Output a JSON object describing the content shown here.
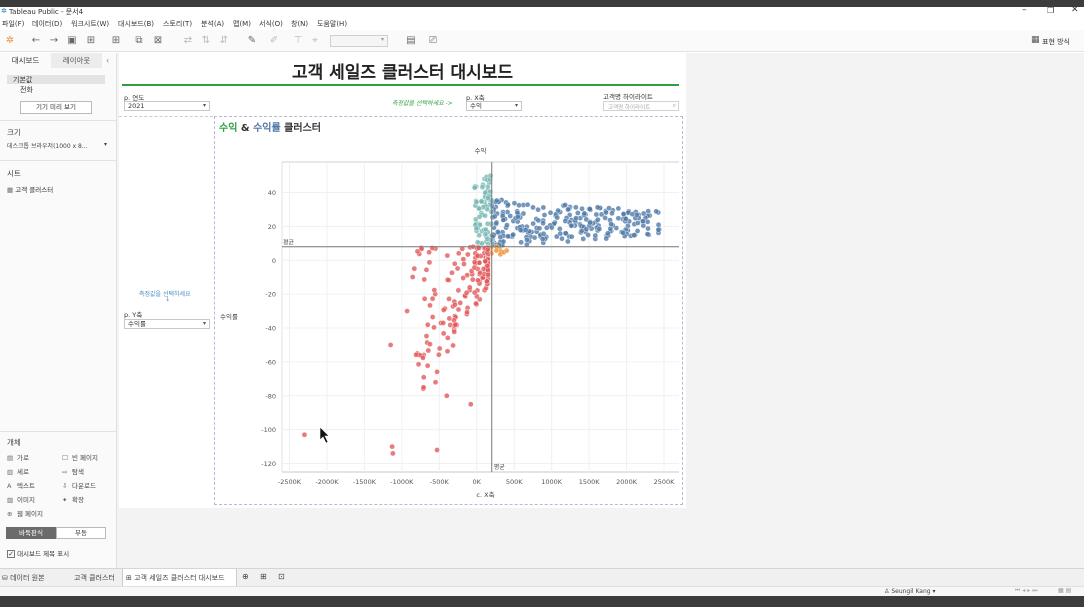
{
  "app": {
    "title": "Tableau Public - 문서4",
    "menu": [
      "파일(F)",
      "데이터(D)",
      "워크시트(W)",
      "대시보드(B)",
      "스토리(T)",
      "분석(A)",
      "맵(M)",
      "서식(O)",
      "창(N)",
      "도움말(H)"
    ],
    "show_me_label": "표현 방식"
  },
  "sidebar": {
    "tabs": [
      "대시보드",
      "레이아웃"
    ],
    "device_items": [
      "기본값",
      "전화"
    ],
    "preview_button": "기기 미리 보기",
    "size_label": "크기",
    "size_value": "데스크톱 브라우저(1000 x 8...",
    "sheets_label": "시트",
    "sheets": [
      "고객 클러스터"
    ],
    "objects_label": "개체",
    "objects": [
      {
        "icon": "horizontal-icon",
        "label": "가로"
      },
      {
        "icon": "blank-icon",
        "label": "빈 페이지"
      },
      {
        "icon": "vertical-icon",
        "label": "세로"
      },
      {
        "icon": "navigation-icon",
        "label": "탐색"
      },
      {
        "icon": "text-icon",
        "label": "텍스트"
      },
      {
        "icon": "download-icon",
        "label": "다운로드"
      },
      {
        "icon": "image-icon",
        "label": "이미지"
      },
      {
        "icon": "extension-icon",
        "label": "확장"
      },
      {
        "icon": "webpage-icon",
        "label": "웹 페이지"
      }
    ],
    "layout_toggle": [
      "바둑판식",
      "부동"
    ],
    "show_title_label": "대시보드 제목 표시"
  },
  "dashboard": {
    "title": "고객 세일즈 클러스터 대시보드",
    "year_param_label": "p. 연도",
    "year_value": "2021",
    "hint_text": "측정값을 선택하세요 ->",
    "x_param_label": "p. X축",
    "x_value": "수익",
    "highlight_label": "고객명 하이라이트",
    "highlight_placeholder": "고객명 하이라이트",
    "left_hint": "측정값을 선택하세요",
    "left_hint_arrow": "↓",
    "y_param_label": "p. Y축",
    "y_value": "수익률",
    "chart_title_part1": "수익",
    "chart_title_amp": " & ",
    "chart_title_part2": "수익률",
    "chart_title_part3": " 클러스터"
  },
  "chart_data": {
    "type": "scatter",
    "top_label": "수익",
    "xlabel": "c. X축",
    "ylabel": "수익률",
    "xlim": [
      -2600,
      2700
    ],
    "ylim": [
      -125,
      58
    ],
    "x_ticks": [
      -2500,
      -2000,
      -1500,
      -1000,
      -500,
      0,
      500,
      1000,
      1500,
      2000,
      2500
    ],
    "x_tick_labels": [
      "-2500K",
      "-2000K",
      "-1500K",
      "-1000K",
      "-500K",
      "0K",
      "500K",
      "1000K",
      "1500K",
      "2000K",
      "2500K"
    ],
    "y_ticks": [
      40,
      20,
      0,
      -20,
      -40,
      -60,
      -80,
      -100,
      -120
    ],
    "reference_lines": {
      "x_avg": 200,
      "y_avg": 8,
      "label": "평균"
    },
    "grid": true,
    "colors": {
      "high_profit_high_margin": "#4e79a7",
      "low_profit_high_margin": "#76b7b2",
      "high_profit_low_margin": "#f28e2b",
      "loss": "#e15759"
    },
    "clusters": [
      {
        "color": "#4e79a7",
        "x_range": [
          200,
          2450
        ],
        "y_range": [
          9,
          45
        ],
        "count": 260
      },
      {
        "color": "#76b7b2",
        "x_range": [
          -30,
          200
        ],
        "y_range": [
          9,
          50
        ],
        "count": 70
      },
      {
        "color": "#f28e2b",
        "x_range": [
          150,
          400
        ],
        "y_range": [
          3,
          8
        ],
        "count": 10
      },
      {
        "color": "#e15759",
        "x_range": [
          -900,
          150
        ],
        "y_range": [
          -85,
          8
        ],
        "count": 170
      }
    ],
    "outliers": [
      {
        "x": -2300,
        "y": -103,
        "color": "#e15759"
      },
      {
        "x": -1130,
        "y": -110,
        "color": "#e15759"
      },
      {
        "x": -1120,
        "y": -114,
        "color": "#e15759"
      },
      {
        "x": -530,
        "y": -112,
        "color": "#e15759"
      },
      {
        "x": -1150,
        "y": -50,
        "color": "#e15759"
      },
      {
        "x": -930,
        "y": -30,
        "color": "#e15759"
      },
      {
        "x": -710,
        "y": -75,
        "color": "#e15759"
      },
      {
        "x": -550,
        "y": -72,
        "color": "#e15759"
      },
      {
        "x": -400,
        "y": -80,
        "color": "#e15759"
      },
      {
        "x": -80,
        "y": -85,
        "color": "#e15759"
      }
    ]
  },
  "bottom_tabs": [
    "데이터 원본",
    "고객 클러스터",
    "고객 세일즈 클러스터 대시보드"
  ],
  "status": {
    "user": "Seungil Kang"
  }
}
